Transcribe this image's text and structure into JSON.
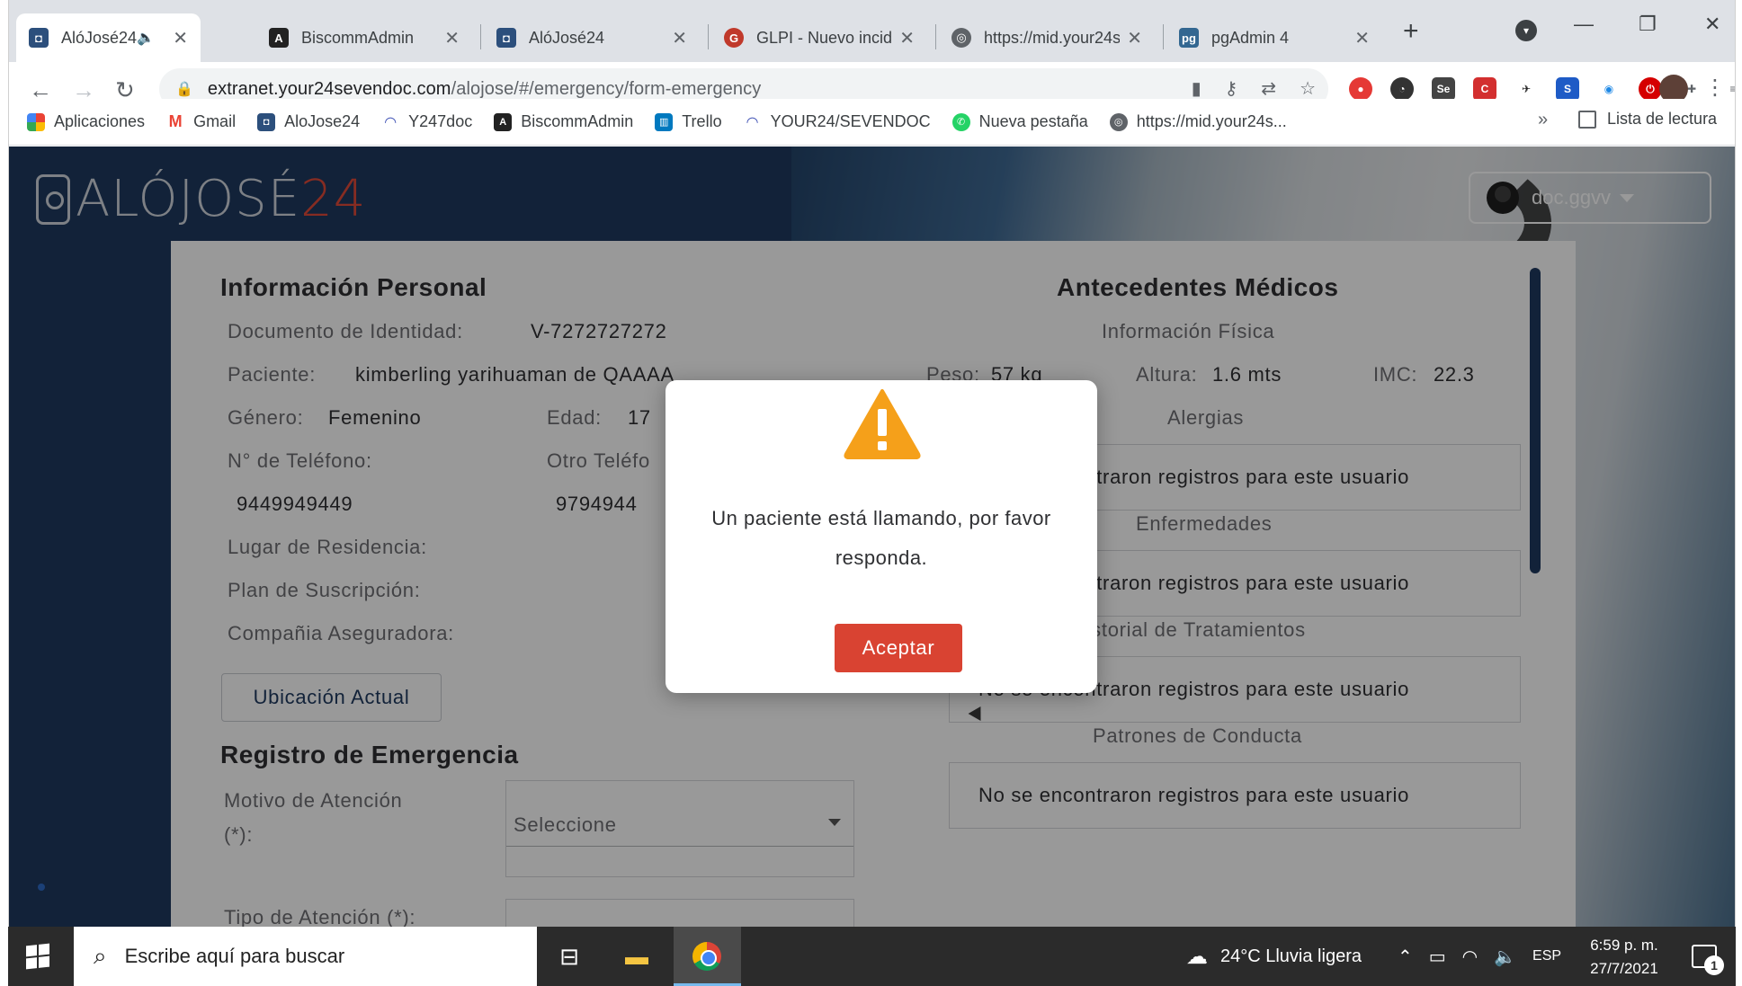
{
  "browser": {
    "tabs": [
      {
        "title": "AlóJosé24",
        "active": true,
        "audio": true
      },
      {
        "title": "BiscommAdmin"
      },
      {
        "title": "AlóJosé24"
      },
      {
        "title": "GLPI - Nuevo incide"
      },
      {
        "title": "https://mid.your24s"
      },
      {
        "title": "pgAdmin 4"
      }
    ],
    "new_tab": "+",
    "url_host": "extranet.your24sevendoc.com",
    "url_path": "/alojose/#/emergency/form-emergency",
    "bookmarks": [
      {
        "label": "Aplicaciones",
        "icon": "apps-grid-icon"
      },
      {
        "label": "Gmail",
        "icon": "gmail-icon"
      },
      {
        "label": "AloJose24",
        "icon": "alojose-icon"
      },
      {
        "label": "Y247doc",
        "icon": "y247-icon"
      },
      {
        "label": "BiscommAdmin",
        "icon": "angular-icon"
      },
      {
        "label": "Trello",
        "icon": "trello-icon"
      },
      {
        "label": "YOUR24/SEVENDOC",
        "icon": "your24-icon"
      },
      {
        "label": "Nueva pestaña",
        "icon": "whatsapp-icon"
      },
      {
        "label": "https://mid.your24s...",
        "icon": "globe-icon"
      }
    ],
    "bookmarks_more": "»",
    "reading_list": "Lista de lectura"
  },
  "app": {
    "logo_text": "ALÓJOSÉ",
    "logo_num": "24",
    "user_name": "doc.ggvv"
  },
  "personal": {
    "title": "Información Personal",
    "doc_label": "Documento de Identidad:",
    "doc_value": "V-7272727272",
    "patient_label": "Paciente:",
    "patient_value": "kimberling yarihuaman de QAAAA",
    "gender_label": "Género:",
    "gender_value": "Femenino",
    "age_label": "Edad:",
    "age_value": "17",
    "phone_label": "N° de Teléfono:",
    "phone_value": "9449949449",
    "other_phone_label": "Otro Teléfo",
    "other_phone_value": "9794944",
    "residence_label": "Lugar de Residencia:",
    "plan_label": "Plan de Suscripción:",
    "insurer_label": "Compañia Aseguradora:",
    "location_button": "Ubicación Actual"
  },
  "emergency": {
    "title": "Registro de Emergencia",
    "reason_label_1": "Motivo de Atención",
    "reason_label_2": "(*):",
    "reason_placeholder": "Seleccione",
    "type_label": "Tipo de Atención (*):"
  },
  "medical": {
    "title": "Antecedentes Médicos",
    "physical_title": "Información Física",
    "weight_label": "Peso:",
    "weight_value": "57 kg",
    "height_label": "Altura:",
    "height_value": "1.6 mts",
    "bmi_label": "IMC:",
    "bmi_value": "22.3",
    "allergies_title": "Alergias",
    "allergies_value": "No se encontraron registros para este usuario",
    "diseases_title": "Enfermedades",
    "diseases_value": "No se encontraron registros para este usuario",
    "treatments_title": "Historial de Tratamientos",
    "treatments_value": "No se encontraron registros para este usuario",
    "behavior_title": "Patrones de Conducta",
    "behavior_value": "No se encontraron registros para este usuario"
  },
  "modal": {
    "message": "Un paciente está llamando, por favor responda.",
    "button": "Aceptar"
  },
  "taskbar": {
    "search_placeholder": "Escribe aquí para buscar",
    "weather": "24°C  Lluvia ligera",
    "lang": "ESP",
    "time": "6:59 p. m.",
    "date": "27/7/2021",
    "notifications": "1"
  },
  "colors": {
    "brand_navy": "#1e3a5f",
    "accent_red": "#d94332",
    "warning_orange": "#f5a01a"
  }
}
